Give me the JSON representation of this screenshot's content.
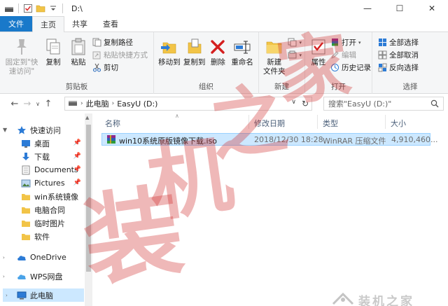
{
  "window": {
    "title": "D:\\",
    "controls": {
      "minimize": "—",
      "maximize": "☐",
      "close": "✕"
    }
  },
  "tabs": [
    {
      "label": "文件"
    },
    {
      "label": "主页"
    },
    {
      "label": "共享"
    },
    {
      "label": "查看"
    }
  ],
  "ribbon": {
    "clipboard": {
      "label": "剪贴板",
      "pin": "固定到\"快\n速访问\"",
      "copy": "复制",
      "paste": "粘贴",
      "copy_path": "复制路径",
      "paste_shortcut": "粘贴快捷方式",
      "cut": "剪切"
    },
    "organize": {
      "label": "组织",
      "move_to": "移动到",
      "copy_to": "复制到",
      "delete": "删除",
      "rename": "重命名"
    },
    "new": {
      "label": "新建",
      "new_folder": "新建\n文件夹"
    },
    "open": {
      "label": "打开",
      "properties": "属性",
      "open": "打开",
      "edit": "编辑",
      "history": "历史记录"
    },
    "select": {
      "label": "选择",
      "select_all": "全部选择",
      "select_none": "全部取消",
      "invert": "反向选择"
    }
  },
  "address": {
    "crumbs": [
      "此电脑",
      "EasyU (D:)"
    ]
  },
  "search": {
    "placeholder": "搜索\"EasyU (D:)\""
  },
  "nav": {
    "items": [
      {
        "label": "快速访问"
      },
      {
        "label": "桌面"
      },
      {
        "label": "下载"
      },
      {
        "label": "Documents"
      },
      {
        "label": "Pictures"
      },
      {
        "label": "win系统镜像"
      },
      {
        "label": "电脑合同"
      },
      {
        "label": "临时图片"
      },
      {
        "label": "软件"
      },
      {
        "label": "OneDrive"
      },
      {
        "label": "WPS网盘"
      },
      {
        "label": "此电脑"
      }
    ]
  },
  "columns": {
    "name": "名称",
    "modified": "修改日期",
    "type": "类型",
    "size": "大小"
  },
  "files": [
    {
      "name": "win10系统原版镜像下载.iso",
      "modified": "2018/12/30 18:28",
      "type": "WinRAR 压缩文件",
      "size": "4,910,460..."
    }
  ],
  "colors": {
    "file_tab": "#1979ca",
    "selection": "#cce8ff",
    "selection_border": "#99d1ff",
    "watermark": "#cd2828"
  },
  "watermark": {
    "chars": [
      "装",
      "机",
      "之",
      "家"
    ]
  }
}
